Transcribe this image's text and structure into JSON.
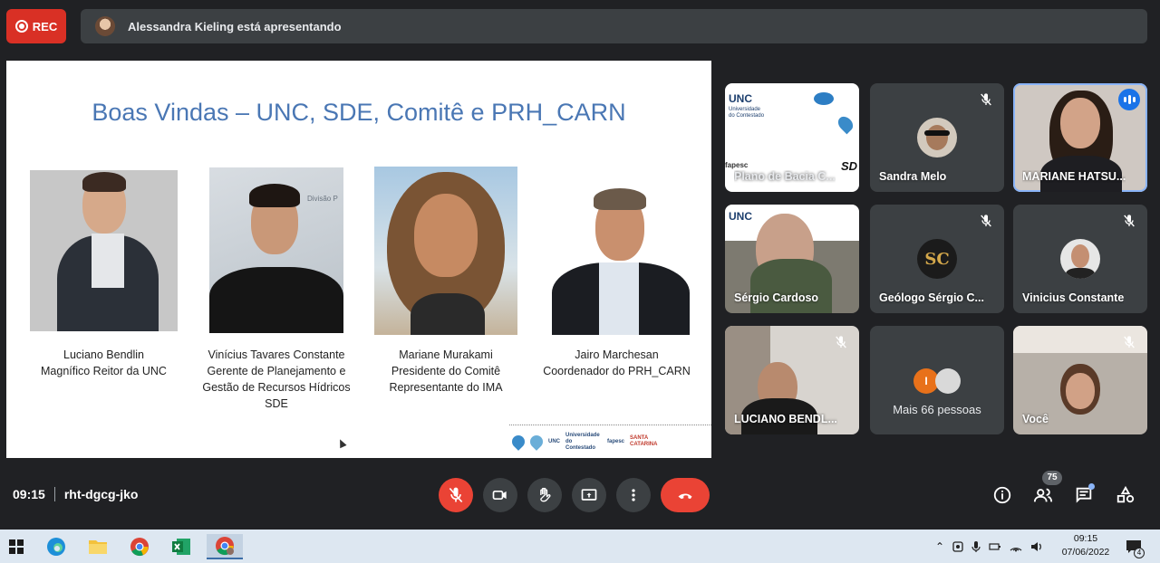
{
  "recording": {
    "label": "REC"
  },
  "presenter_bar": {
    "text": "Alessandra Kieling está apresentando"
  },
  "slide": {
    "title": "Boas Vindas – UNC, SDE, Comitê e PRH_CARN",
    "people": [
      {
        "lines": [
          "Luciano Bendlin",
          "Magnífico Reitor da UNC"
        ]
      },
      {
        "lines": [
          "Vinícius Tavares Constante",
          "Gerente de Planejamento e",
          "Gestão de Recursos Hídricos",
          "SDE"
        ]
      },
      {
        "lines": [
          "Mariane Murakami",
          "Presidente do Comitê",
          "Representante do IMA"
        ]
      },
      {
        "lines": [
          "Jairo Marchesan",
          "Coordenador do PRH_CARN"
        ]
      }
    ],
    "footer_logos": [
      "UNC",
      "Universidade do Contestado",
      "fapesc",
      "SANTA CATARINA"
    ]
  },
  "participants": [
    {
      "name": "Plano de Bacia C...",
      "muted": true,
      "kind": "screen"
    },
    {
      "name": "Sandra Melo",
      "muted": true,
      "kind": "avatar"
    },
    {
      "name": "MARIANE HATSU...",
      "muted": false,
      "kind": "video",
      "speaking": true
    },
    {
      "name": "Sérgio Cardoso",
      "muted": true,
      "kind": "screen-video"
    },
    {
      "name": "Geólogo Sérgio C...",
      "muted": true,
      "kind": "avatar"
    },
    {
      "name": "Vinicius Constante",
      "muted": true,
      "kind": "avatar"
    },
    {
      "name": "LUCIANO BENDL...",
      "muted": true,
      "kind": "video"
    },
    {
      "more_label": "Mais 66 pessoas",
      "chip_letter": "I",
      "kind": "more"
    },
    {
      "name": "Você",
      "muted": true,
      "kind": "video"
    }
  ],
  "slide_thumb": {
    "brand_lines": [
      "UNC",
      "Universidade",
      "do Contestado"
    ],
    "sd_label": "SD",
    "fapesc": "fapesc"
  },
  "avatar_letters": {
    "geologo": "SC"
  },
  "meeting": {
    "time": "09:15",
    "code": "rht-dgcg-jko"
  },
  "controls": {
    "participants_count": "75"
  },
  "taskbar": {
    "clock_time": "09:15",
    "clock_date": "07/06/2022",
    "notification_count": "4"
  },
  "colors": {
    "accent": "#1a73e8",
    "danger": "#ea4335",
    "slide_title": "#4a77b4",
    "bg": "#202124",
    "tile": "#3c4043"
  }
}
